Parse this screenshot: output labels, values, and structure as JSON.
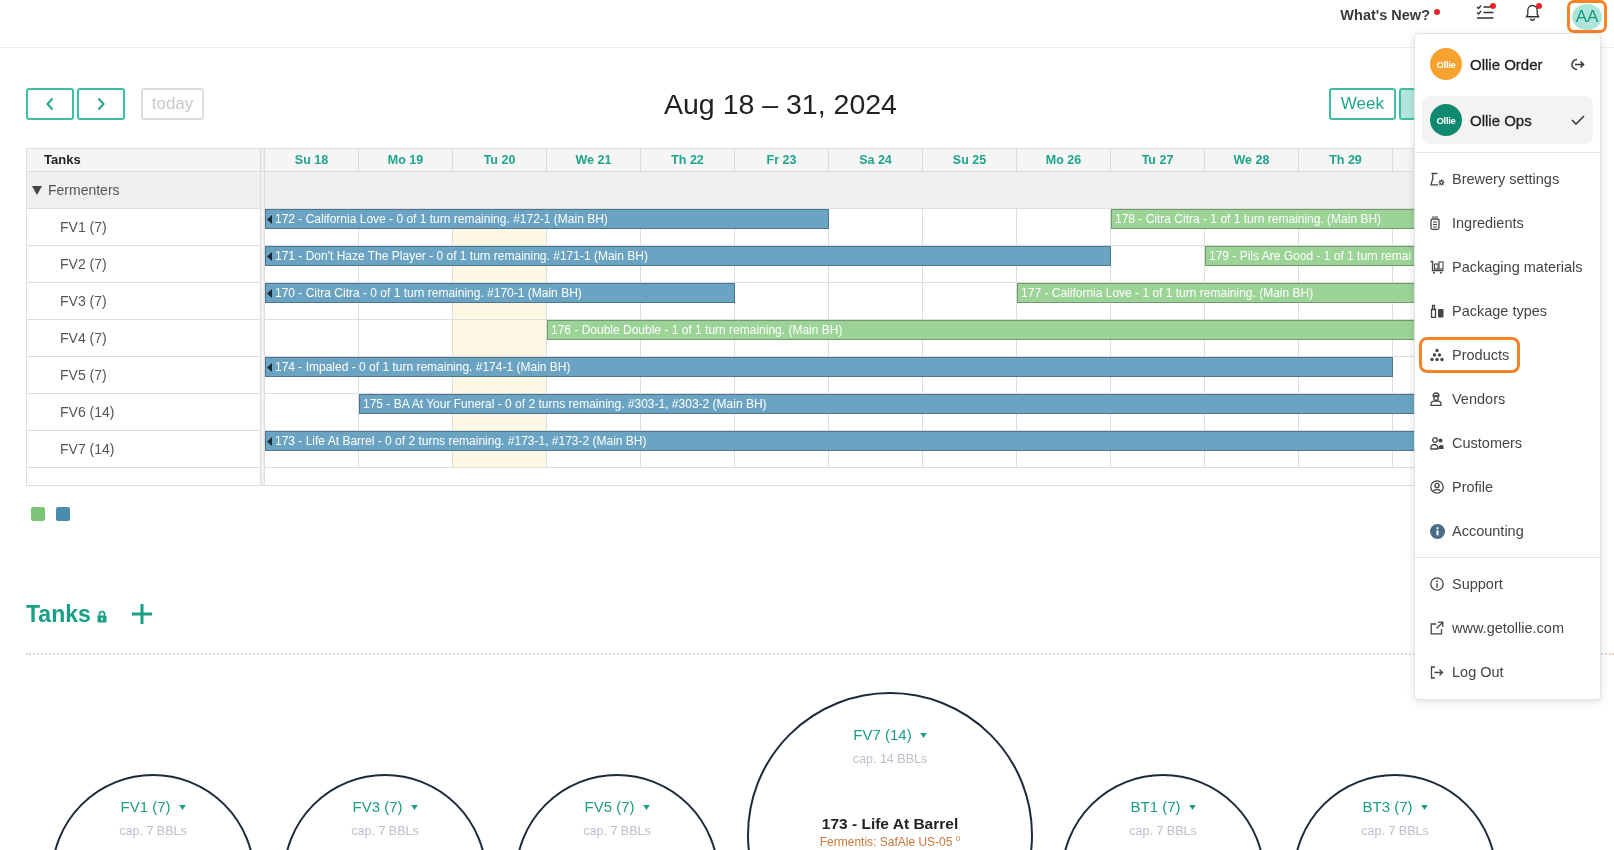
{
  "header": {
    "whats_new": {
      "label": "What's New?",
      "unread": true
    },
    "tasks": {
      "unread": true
    },
    "notifications": {
      "unread": true
    },
    "avatar": {
      "initials": "AA",
      "highlighted": true
    }
  },
  "toolbar": {
    "today": {
      "label": "today",
      "disabled": true
    },
    "title": "Aug 18 – 31, 2024",
    "views": [
      {
        "label": "Week",
        "selected": false
      },
      {
        "selected": true
      }
    ]
  },
  "calendar": {
    "resource_header": "Tanks",
    "days": [
      {
        "label": "Su 18",
        "today": false
      },
      {
        "label": "Mo 19",
        "today": false
      },
      {
        "label": "Tu 20",
        "today": true
      },
      {
        "label": "We 21",
        "today": false
      },
      {
        "label": "Th 22",
        "today": false
      },
      {
        "label": "Fr 23",
        "today": false
      },
      {
        "label": "Sa 24",
        "today": false
      },
      {
        "label": "Su 25",
        "today": false
      },
      {
        "label": "Mo 26",
        "today": false
      },
      {
        "label": "Tu 27",
        "today": false
      },
      {
        "label": "We 28",
        "today": false
      },
      {
        "label": "Th 29",
        "today": false
      }
    ],
    "groups": [
      {
        "label": "Fermenters",
        "expanded": true,
        "resources": [
          {
            "name": "FV1 (7)",
            "events": [
              {
                "title": "172 - California Love - 0 of 1 turn remaining. #172-1 (Main BH)",
                "level": 0.4909,
                "continues_before": true,
                "color": "#6aa4c2"
              },
              {
                "title": "178 - Citra Citra - 1 of 1 turn remaining. (Main BH)",
                "level": 0.2637,
                "continues_before": false,
                "color": "#9cd497"
              }
            ]
          },
          {
            "name": "FV2 (7)",
            "events": [
              {
                "title": "171 - Don't Haze The Player - 0 of 1 turn remaining. #171-1 (Main BH)",
                "level": 0.7363,
                "continues_before": true,
                "color": "#6aa4c2"
              },
              {
                "title": "179 - Pils Are Good - 1 of 1 turn remai",
                "level": 0.1819,
                "continues_before": false,
                "color": "#9cd497"
              }
            ]
          },
          {
            "name": "FV3 (7)",
            "events": [
              {
                "title": "170 - Citra Citra - 0 of 1 turn remaining. #170-1 (Main BH)",
                "level": 0.409,
                "continues_before": true,
                "color": "#6aa4c2"
              },
              {
                "title": "177 - California Love - 1 of 1 turn remaining. (Main BH)",
                "level": 0.3455,
                "continues_before": false,
                "color": "#9cd497"
              }
            ]
          },
          {
            "name": "FV4 (7)",
            "events": [
              {
                "title": "176 - Double Double - 1 of 1 turn remaining. (Main BH)",
                "level": 0.7546,
                "continues_before": false,
                "color": "#9cd497"
              }
            ]
          },
          {
            "name": "FV5 (7)",
            "events": [
              {
                "title": "174 - Impaled - 0 of 1 turn remaining. #174-1 (Main BH)",
                "level": 0.9817,
                "continues_before": true,
                "color": "#6aa4c2"
              }
            ]
          },
          {
            "name": "FV6 (14)",
            "events": [
              {
                "title": "175 - BA At Your Funeral - 0 of 2 turns remaining. #303-1, #303-2 (Main BH)",
                "level": 0.9182,
                "continues_before": false,
                "color": "#6aa4c2"
              }
            ]
          },
          {
            "name": "FV7 (14)",
            "events": [
              {
                "title": "173 - Life At Barrel - 0 of 2 turns remaining. #173-1, #173-2 (Main BH)",
                "level": 1,
                "continues_before": true,
                "color": "#6aa4c2"
              }
            ]
          }
        ]
      }
    ]
  },
  "legend": [
    {
      "color": "#7cc476"
    },
    {
      "color": "#4a8cb0"
    }
  ],
  "tanks": {
    "title": "Tanks",
    "locked": true,
    "list": [
      {
        "name": "FV1 (7)",
        "capacity": "cap. 7 BBLs",
        "kind": "small"
      },
      {
        "name": "FV3 (7)",
        "capacity": "cap. 7 BBLs",
        "kind": "small"
      },
      {
        "name": "FV5 (7)",
        "capacity": "cap. 7 BBLs",
        "kind": "small"
      },
      {
        "name": "FV7 (14)",
        "capacity": "cap. 14 BBLs",
        "kind": "large",
        "batch": "173 - Life At Barrel",
        "yeast": "Fermentis: SafAle US-05 $^{0}$"
      },
      {
        "name": "BT1 (7)",
        "capacity": "cap. 7 BBLs",
        "kind": "small"
      },
      {
        "name": "BT3 (7)",
        "capacity": "cap. 7 BBLs",
        "kind": "small"
      }
    ]
  },
  "account_menu": {
    "apps": [
      {
        "name": "Ollie Order",
        "logo": "Ollie",
        "color": "#f7a12e",
        "selected": false
      },
      {
        "name": "Ollie Ops",
        "logo": "Ollie",
        "color": "#0f8a70",
        "selected": true
      }
    ],
    "items": [
      {
        "label": "Brewery settings",
        "highlighted": false
      },
      {
        "label": "Ingredients",
        "highlighted": false
      },
      {
        "label": "Packaging materials",
        "highlighted": false
      },
      {
        "label": "Package types",
        "highlighted": false
      },
      {
        "label": "Products",
        "highlighted": true
      },
      {
        "label": "Vendors",
        "highlighted": false
      },
      {
        "label": "Customers",
        "highlighted": false
      },
      {
        "label": "Profile",
        "highlighted": false
      },
      {
        "label": "Accounting",
        "highlighted": false
      }
    ],
    "links": [
      "Support",
      "www.getollie.com",
      "Log Out"
    ]
  }
}
